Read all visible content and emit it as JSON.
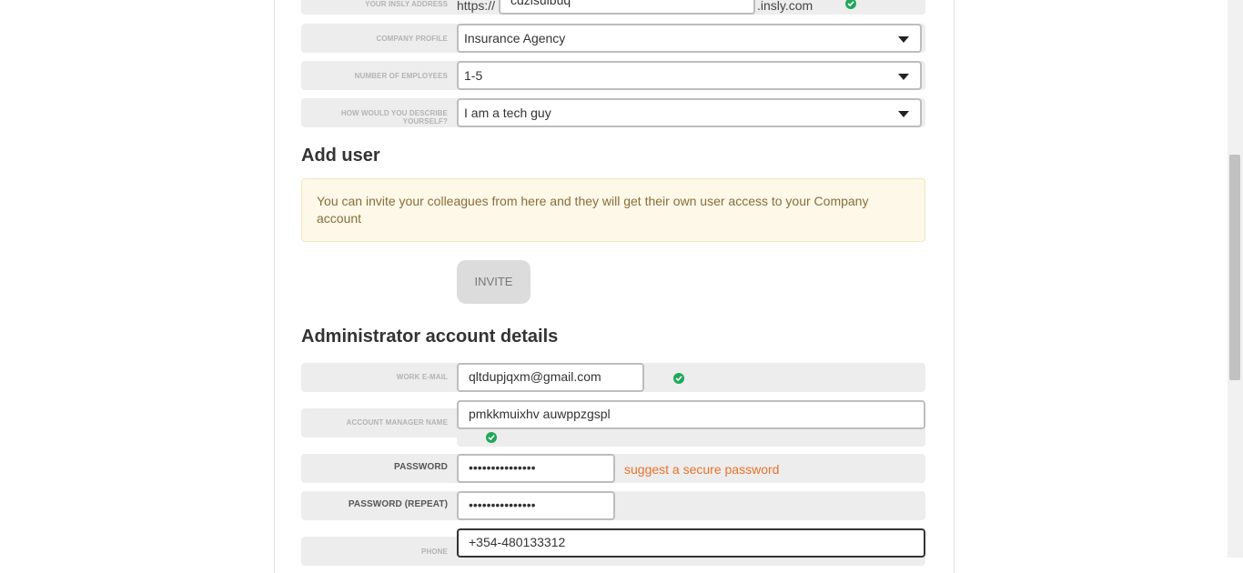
{
  "insly_address": {
    "label": "YOUR INSLY ADDRESS",
    "prefix": "https://",
    "value": "cdzisulbuq",
    "suffix": ".insly.com"
  },
  "company_profile": {
    "label": "COMPANY PROFILE",
    "value": "Insurance Agency"
  },
  "employees": {
    "label": "NUMBER OF EMPLOYEES",
    "value": "1-5"
  },
  "describe": {
    "label": "HOW WOULD YOU DESCRIBE YOURSELF?",
    "value": "I am a tech guy"
  },
  "add_user": {
    "title": "Add user",
    "notice": "You can invite your colleagues from here and they will get their own user access to your Company account",
    "invite_label": "INVITE"
  },
  "admin": {
    "title": "Administrator account details",
    "email_label": "WORK E-MAIL",
    "email_value": "qltdupjqxm@gmail.com",
    "manager_label": "ACCOUNT MANAGER NAME",
    "manager_value": "pmkkmuixhv auwppzgspl",
    "password_label": "PASSWORD",
    "password_value": "•••••••••••••••",
    "suggest_label": "suggest a secure password",
    "password_repeat_label": "PASSWORD (REPEAT)",
    "password_repeat_value": "•••••••••••••••",
    "phone_label": "PHONE",
    "phone_value": "+354-480133312"
  },
  "colors": {
    "check": "#1fa85a",
    "link": "#e8732a",
    "notice_bg": "#fdf8e8"
  }
}
